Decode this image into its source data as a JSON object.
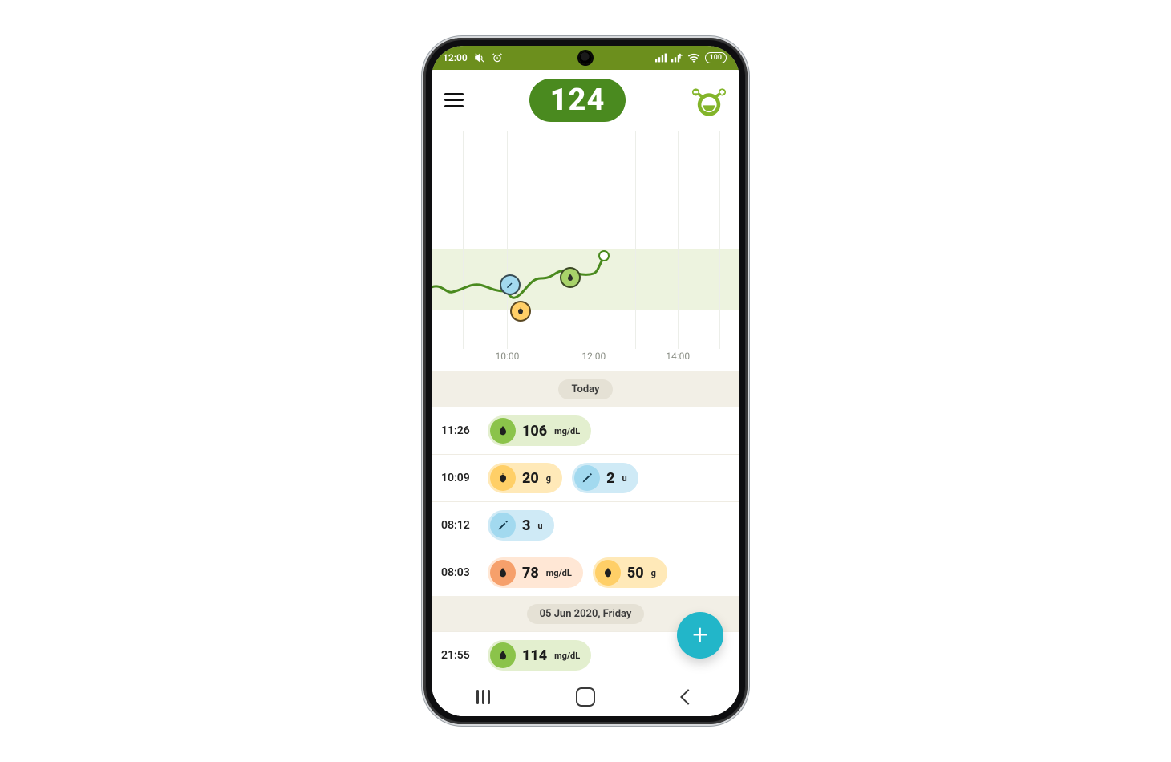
{
  "status": {
    "time": "12:00",
    "battery": "100"
  },
  "header": {
    "current_reading": "124"
  },
  "chart_data": {
    "type": "line",
    "xlabel": "",
    "ylabel": "",
    "x_ticks": [
      "10:00",
      "12:00",
      "14:00"
    ],
    "x_range_hours": [
      8.2,
      15.5
    ],
    "target_band_mgdl": [
      80,
      140
    ],
    "y_range_mgdl": [
      40,
      260
    ],
    "series": [
      {
        "name": "glucose",
        "unit": "mg/dL",
        "points": [
          {
            "t": 8.2,
            "v": 102
          },
          {
            "t": 8.6,
            "v": 96
          },
          {
            "t": 9.0,
            "v": 104
          },
          {
            "t": 9.5,
            "v": 100
          },
          {
            "t": 10.0,
            "v": 96
          },
          {
            "t": 10.15,
            "v": 92
          },
          {
            "t": 10.5,
            "v": 108
          },
          {
            "t": 10.9,
            "v": 116
          },
          {
            "t": 11.26,
            "v": 114
          },
          {
            "t": 11.6,
            "v": 110
          },
          {
            "t": 11.9,
            "v": 112
          },
          {
            "t": 12.1,
            "v": 122
          },
          {
            "t": 12.2,
            "v": 124
          }
        ]
      }
    ],
    "events": [
      {
        "t": 10.0,
        "kind": "insulin",
        "label": "insulin"
      },
      {
        "t": 10.25,
        "kind": "carbs",
        "label": "carbs"
      },
      {
        "t": 11.43,
        "kind": "glucose",
        "label": "glucose reading"
      }
    ]
  },
  "log": {
    "sections": [
      {
        "label": "Today",
        "entries": [
          {
            "time": "11:26",
            "items": [
              {
                "type": "glucose",
                "value": "106",
                "unit": "mg/dL",
                "tone": "good"
              }
            ]
          },
          {
            "time": "10:09",
            "items": [
              {
                "type": "carbs",
                "value": "20",
                "unit": "g"
              },
              {
                "type": "insulin",
                "value": "2",
                "unit": "u"
              }
            ]
          },
          {
            "time": "08:12",
            "items": [
              {
                "type": "insulin",
                "value": "3",
                "unit": "u"
              }
            ]
          },
          {
            "time": "08:03",
            "items": [
              {
                "type": "glucose",
                "value": "78",
                "unit": "mg/dL",
                "tone": "warm"
              },
              {
                "type": "carbs",
                "value": "50",
                "unit": "g"
              }
            ]
          }
        ]
      },
      {
        "label": "05 Jun 2020, Friday",
        "entries": [
          {
            "time": "21:55",
            "items": [
              {
                "type": "glucose",
                "value": "114",
                "unit": "mg/dL",
                "tone": "good"
              }
            ]
          }
        ]
      }
    ]
  },
  "fab": {
    "label": "+"
  }
}
